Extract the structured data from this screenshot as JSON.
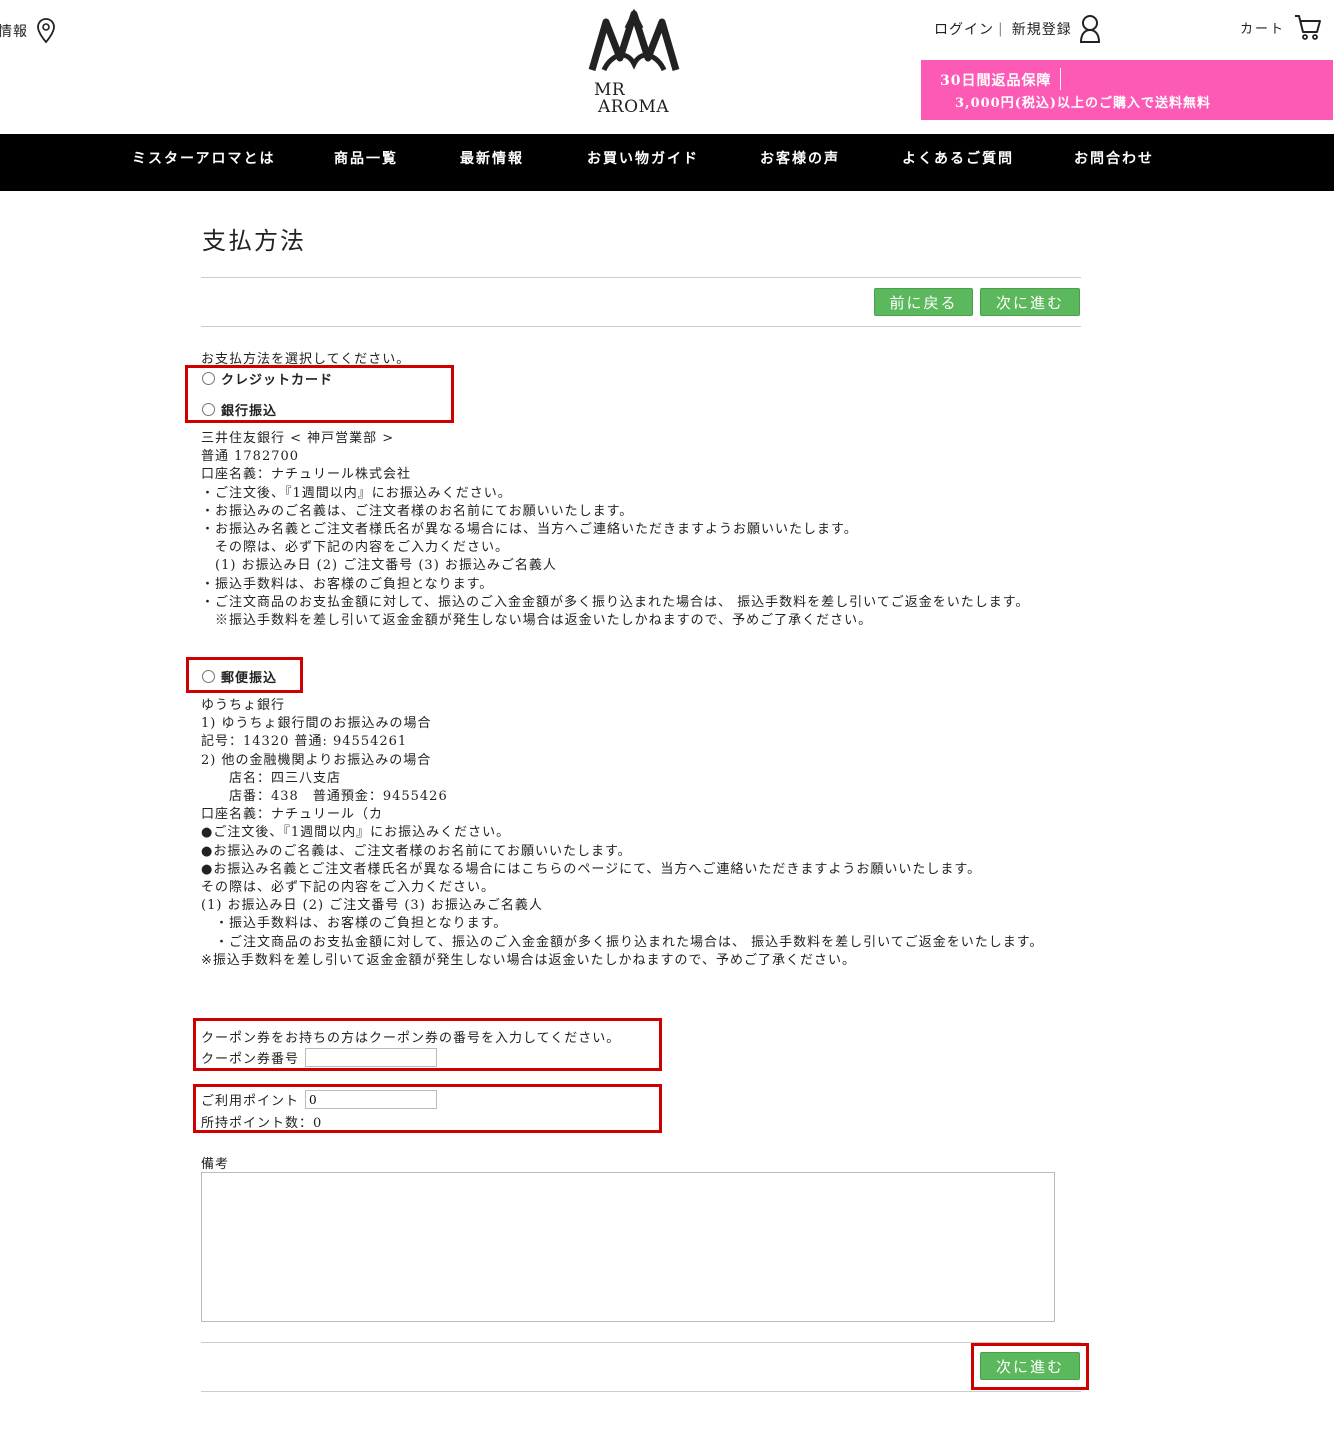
{
  "header": {
    "store_info": "情報",
    "logo_line1": "MR",
    "logo_line2": "AROMA",
    "login": "ログイン",
    "separator": "|",
    "register": "新規登録",
    "cart": "カート",
    "promo_line1": "30日間返品保障",
    "promo_line2": "3,000円(税込)以上のご購入で送料無料"
  },
  "nav": {
    "items": [
      {
        "label": "ミスターアロマとは"
      },
      {
        "label": "商品一覧"
      },
      {
        "label": "最新情報"
      },
      {
        "label": "お買い物ガイド"
      },
      {
        "label": "お客様の声"
      },
      {
        "label": "よくあるご質問"
      },
      {
        "label": "お問合わせ"
      }
    ]
  },
  "main": {
    "title": "支払方法",
    "back_button": "前に戻る",
    "next_button": "次に進む",
    "instruction": "お支払方法を選択してください。",
    "payment_options": {
      "credit": "クレジットカード",
      "bank": "銀行振込",
      "postal": "郵便振込"
    },
    "bank_details": "三井住友銀行 < 神戸営業部 >\n普通 1782700\n口座名義：ナチュリール株式会社\n・ご注文後、『1週間以内』にお振込みください。\n・お振込みのご名義は、ご注文者様のお名前にてお願いいたします。\n・お振込み名義とご注文者様氏名が異なる場合には、当方へご連絡いただきますようお願いいたします。\n　その際は、必ず下記の内容をご入力ください。\n　(1) お振込み日 (2) ご注文番号 (3) お振込みご名義人\n・振込手数料は、お客様のご負担となります。\n・ご注文商品のお支払金額に対して、振込のご入金金額が多く振り込まれた場合は、 振込手数料を差し引いてご返金をいたします。\n　※振込手数料を差し引いて返金金額が発生しない場合は返金いたしかねますので、予めご了承ください。",
    "postal_details": "ゆうちょ銀行\n1) ゆうちょ銀行間のお振込みの場合\n記号：14320 普通: 94554261\n2) 他の金融機関よりお振込みの場合\n　　店名：四三八支店\n　　店番：438　普通預金：9455426\n口座名義：ナチュリール（カ\n●ご注文後、『1週間以内』にお振込みください。\n●お振込みのご名義は、ご注文者様のお名前にてお願いいたします。\n●お振込み名義とご注文者様氏名が異なる場合にはこちらのページにて、当方へご連絡いただきますようお願いいたします。\nその際は、必ず下記の内容をご入力ください。\n(1) お振込み日 (2) ご注文番号 (3) お振込みご名義人\n　・振込手数料は、お客様のご負担となります。\n　・ご注文商品のお支払金額に対して、振込のご入金金額が多く振り込まれた場合は、 振込手数料を差し引いてご返金をいたします。\n※振込手数料を差し引いて返金金額が発生しない場合は返金いたしかねますので、予めご了承ください。",
    "coupon_prompt": "クーポン券をお持ちの方はクーポン券の番号を入力してください。",
    "coupon_label": "クーポン券番号",
    "coupon_value": "",
    "points_label": "ご利用ポイント",
    "points_value": "0",
    "points_owned_label": "所持ポイント数：0",
    "remarks_label": "備考",
    "remarks_value": ""
  }
}
